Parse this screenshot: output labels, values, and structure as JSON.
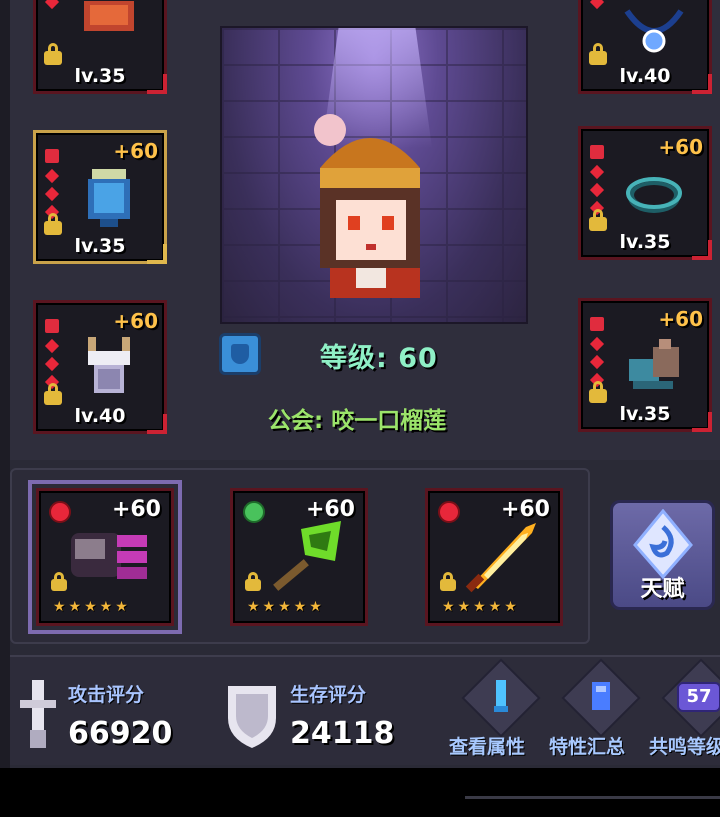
{
  "armor_slots": [
    {
      "level": "lv.35",
      "bonus": ""
    },
    {
      "level": "lv.40",
      "bonus": ""
    },
    {
      "level": "lv.35",
      "bonus": "+60"
    },
    {
      "level": "lv.35",
      "bonus": "+60"
    },
    {
      "level": "lv.40",
      "bonus": "+60"
    },
    {
      "level": "lv.35",
      "bonus": "+60"
    }
  ],
  "character": {
    "level_text": "等级: 60",
    "guild_text": "公会: 咬一口榴莲"
  },
  "weapons": [
    {
      "bonus": "+60",
      "stars": "★★★★★",
      "element": "red"
    },
    {
      "bonus": "+60",
      "stars": "★★★★★",
      "element": "green"
    },
    {
      "bonus": "+60",
      "stars": "★★★★★",
      "element": "red"
    }
  ],
  "talent": {
    "label": "天赋"
  },
  "stats": {
    "attack_label": "攻击评分",
    "attack_value": "66920",
    "survival_label": "生存评分",
    "survival_value": "24118"
  },
  "menu": {
    "view_attributes": "查看属性",
    "trait_summary": "特性汇总",
    "resonance_level": "共鸣等级",
    "resonance_badge": "57"
  },
  "colors": {
    "background": "#2a2a36",
    "level_text": "#8ff0c6",
    "guild_text": "#9be46a",
    "bonus_gold": "#ffc24a",
    "stat_label": "#a9c5ff"
  }
}
